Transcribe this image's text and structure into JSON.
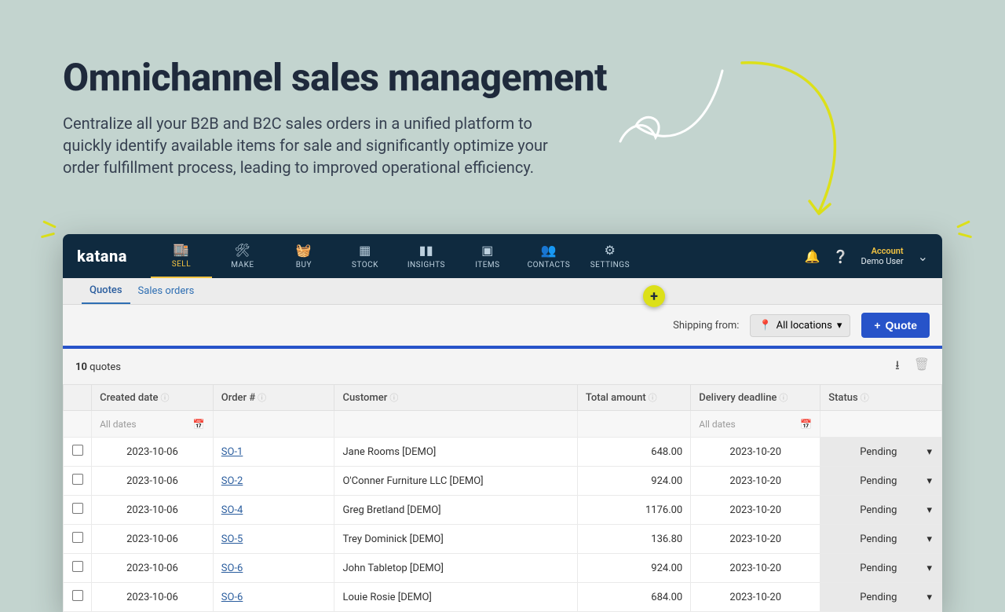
{
  "hero": {
    "title": "Omnichannel sales management",
    "subtitle": "Centralize all your B2B and B2C sales orders in a unified platform to quickly identify available items for sale and significantly optimize your order fulfillment process, leading to improved operational efficiency."
  },
  "brand": "katana",
  "nav": [
    {
      "label": "SELL"
    },
    {
      "label": "MAKE"
    },
    {
      "label": "BUY"
    },
    {
      "label": "STOCK"
    },
    {
      "label": "INSIGHTS"
    },
    {
      "label": "ITEMS"
    },
    {
      "label": "CONTACTS"
    },
    {
      "label": "SETTINGS"
    }
  ],
  "account": {
    "label": "Account",
    "user": "Demo User"
  },
  "subtabs": {
    "quotes": "Quotes",
    "orders": "Sales orders"
  },
  "toolbar": {
    "shipping_label": "Shipping from:",
    "location": "All locations",
    "quote_btn": "Quote"
  },
  "list": {
    "count": "10",
    "count_label": "quotes"
  },
  "columns": {
    "created": "Created date",
    "order": "Order #",
    "customer": "Customer",
    "total": "Total amount",
    "deadline": "Delivery deadline",
    "status": "Status"
  },
  "filters": {
    "all_dates": "All dates"
  },
  "rows": [
    {
      "created": "2023-10-06",
      "order": "SO-1",
      "customer": "Jane Rooms [DEMO]",
      "total": "648.00",
      "deadline": "2023-10-20",
      "status": "Pending"
    },
    {
      "created": "2023-10-06",
      "order": "SO-2",
      "customer": "O'Conner Furniture LLC [DEMO]",
      "total": "924.00",
      "deadline": "2023-10-20",
      "status": "Pending"
    },
    {
      "created": "2023-10-06",
      "order": "SO-4",
      "customer": "Greg Bretland [DEMO]",
      "total": "1176.00",
      "deadline": "2023-10-20",
      "status": "Pending"
    },
    {
      "created": "2023-10-06",
      "order": "SO-5",
      "customer": "Trey Dominick [DEMO]",
      "total": "136.80",
      "deadline": "2023-10-20",
      "status": "Pending"
    },
    {
      "created": "2023-10-06",
      "order": "SO-6",
      "customer": "John Tabletop [DEMO]",
      "total": "924.00",
      "deadline": "2023-10-20",
      "status": "Pending"
    },
    {
      "created": "2023-10-06",
      "order": "SO-6",
      "customer": "Louie Rosie [DEMO]",
      "total": "684.00",
      "deadline": "2023-10-20",
      "status": "Pending"
    }
  ]
}
